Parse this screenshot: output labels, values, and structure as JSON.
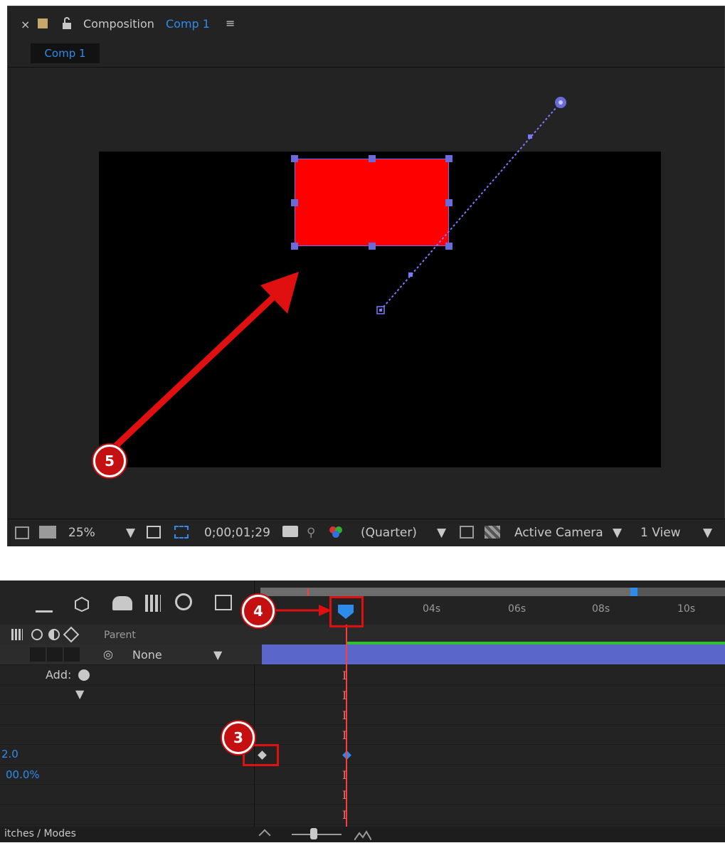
{
  "composition_panel": {
    "close_glyph": "×",
    "panel_label": "Composition",
    "comp_name": "Comp 1",
    "menu_glyph": "≡",
    "tab_label": "Comp 1"
  },
  "viewer_footer": {
    "zoom": "25%",
    "timecode": "0;00;01;29",
    "resolution": "(Quarter)",
    "camera": "Active Camera",
    "views": "1 View"
  },
  "timeline": {
    "parent_header": "Parent",
    "parent_value": "None",
    "add_label": "Add:",
    "ruler_ticks": [
      "04s",
      "06s",
      "08s",
      "10s"
    ],
    "value_1": "2.0",
    "value_2": "00.0%",
    "bottom_label": "itches / Modes"
  },
  "callouts": {
    "c3": "3",
    "c4": "4",
    "c5": "5"
  },
  "colors": {
    "accent": "#2d8ceb",
    "shape_fill": "#ff0000",
    "layer_bar": "#5a66c9",
    "callout": "#c41010",
    "playhead": "#ff3c3c"
  }
}
